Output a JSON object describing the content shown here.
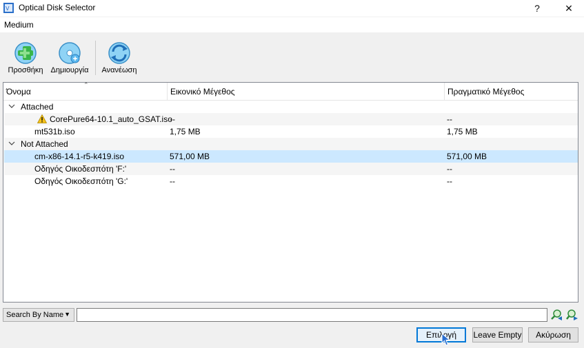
{
  "window": {
    "title": "Optical Disk Selector",
    "help_label": "?",
    "close_label": "✕"
  },
  "menu": {
    "medium": "Medium"
  },
  "toolbar": {
    "add": {
      "label": "Προσθήκη",
      "icon": "add-disk-icon"
    },
    "create": {
      "label": "Δημιουργία",
      "icon": "create-disk-icon"
    },
    "refresh": {
      "label": "Ανανέωση",
      "icon": "refresh-icon"
    }
  },
  "table": {
    "columns": [
      "Όνομα",
      "Εικονικό Μέγεθος",
      "Πραγματικό Μέγεθος"
    ],
    "groups": [
      {
        "label": "Attached",
        "rows": [
          {
            "name": "CorePure64-10.1_auto_GSAT.iso",
            "virtual": "--",
            "actual": "--",
            "warning": true
          },
          {
            "name": "mt531b.iso",
            "virtual": "1,75 MB",
            "actual": "1,75 MB"
          }
        ]
      },
      {
        "label": "Not Attached",
        "rows": [
          {
            "name": "cm-x86-14.1-r5-k419.iso",
            "virtual": "571,00 MB",
            "actual": "571,00 MB",
            "selected": true
          },
          {
            "name": "Οδηγός Οικοδεσπότη 'F:'",
            "virtual": "--",
            "actual": "--"
          },
          {
            "name": "Οδηγός Οικοδεσπότη 'G:'",
            "virtual": "--",
            "actual": "--"
          }
        ]
      }
    ]
  },
  "search": {
    "mode": "Search By Name",
    "value": ""
  },
  "buttons": {
    "choose": "Επιλογή",
    "leave_empty": "Leave Empty",
    "cancel": "Ακύρωση"
  },
  "colors": {
    "selection": "#cce8ff",
    "accent": "#0078d7"
  }
}
